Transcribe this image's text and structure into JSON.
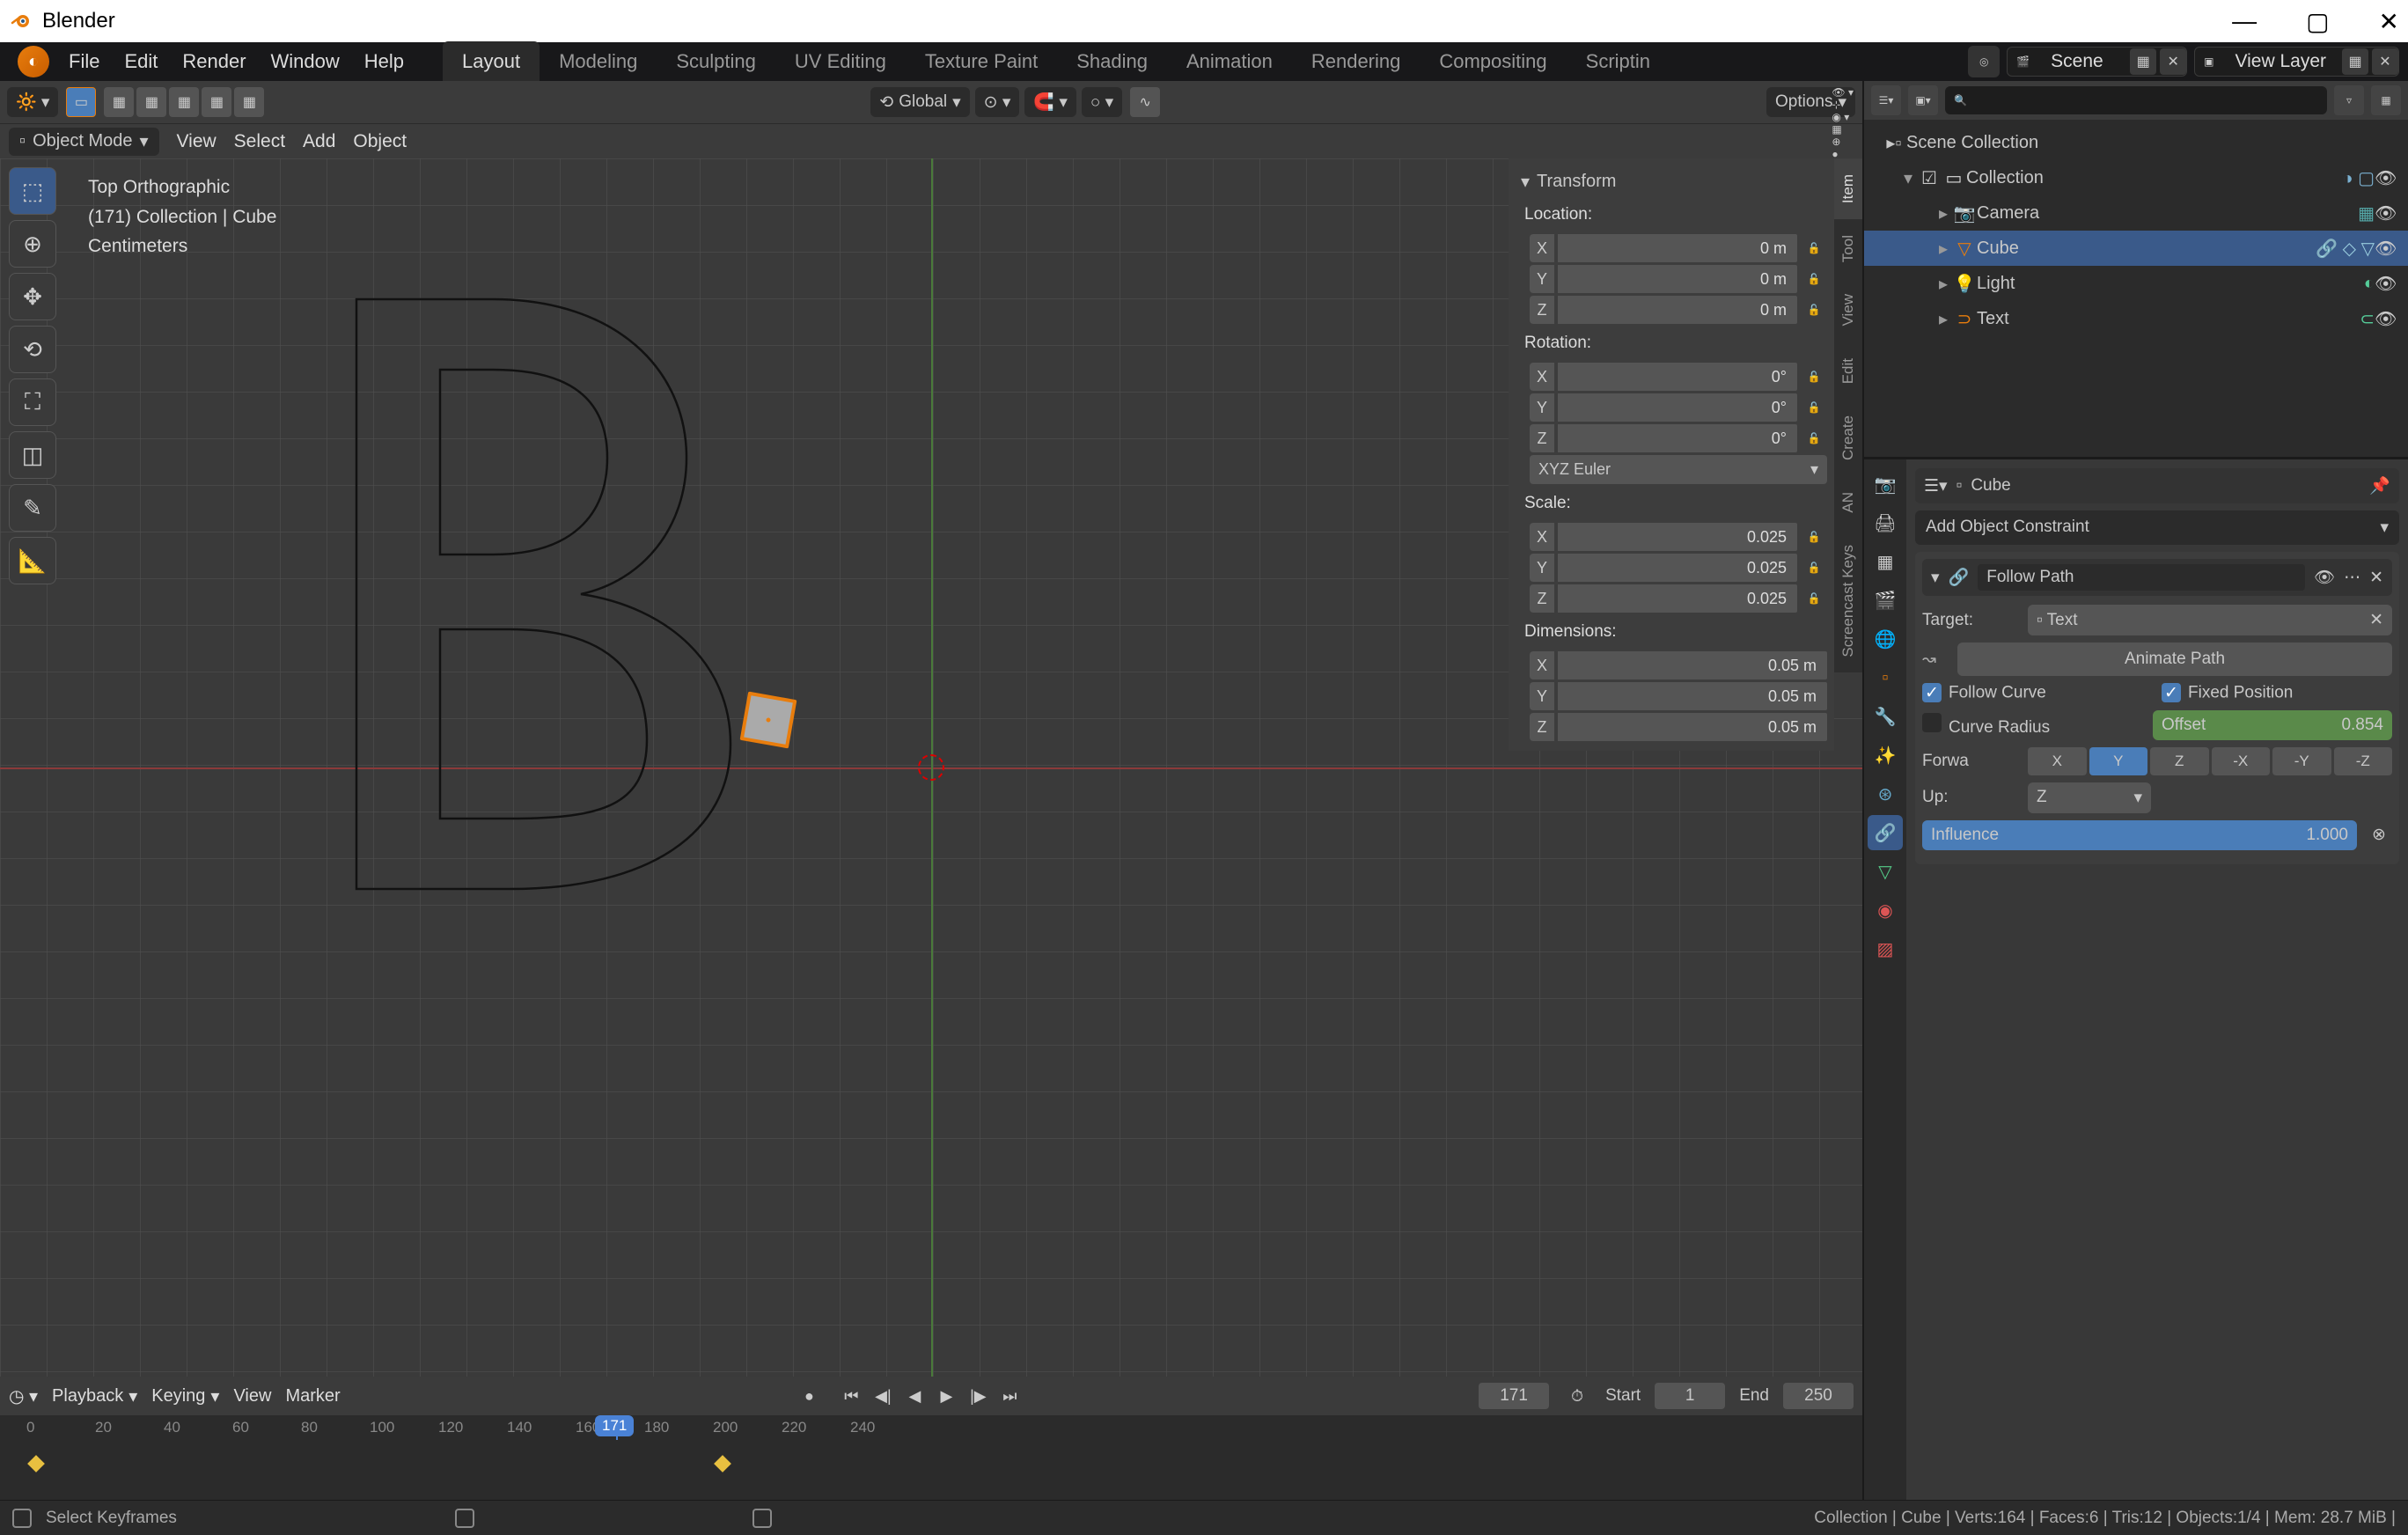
{
  "app": {
    "title": "Blender"
  },
  "menus": [
    "File",
    "Edit",
    "Render",
    "Window",
    "Help"
  ],
  "workspace_tabs": [
    "Layout",
    "Modeling",
    "Sculpting",
    "UV Editing",
    "Texture Paint",
    "Shading",
    "Animation",
    "Rendering",
    "Compositing",
    "Scriptin"
  ],
  "workspace_active": "Layout",
  "scene": {
    "name": "Scene"
  },
  "view_layer": {
    "name": "View Layer"
  },
  "viewport_header": {
    "orientation": "Global",
    "options": "Options"
  },
  "mode": {
    "label": "Object Mode"
  },
  "header_menus": [
    "View",
    "Select",
    "Add",
    "Object"
  ],
  "viewport_info": {
    "view": "Top Orthographic",
    "context": "(171) Collection | Cube",
    "units": "Centimeters"
  },
  "npanel": {
    "title": "Transform",
    "tabs": [
      "Item",
      "Tool",
      "View",
      "Edit",
      "Create",
      "AN",
      "Screencast Keys"
    ],
    "active_tab": "Item",
    "location": {
      "label": "Location:",
      "x": "0 m",
      "y": "0 m",
      "z": "0 m"
    },
    "rotation": {
      "label": "Rotation:",
      "x": "0°",
      "y": "0°",
      "z": "0°",
      "mode": "XYZ Euler"
    },
    "scale": {
      "label": "Scale:",
      "x": "0.025",
      "y": "0.025",
      "z": "0.025"
    },
    "dimensions": {
      "label": "Dimensions:",
      "x": "0.05 m",
      "y": "0.05 m",
      "z": "0.05 m"
    }
  },
  "outliner": {
    "root": "Scene Collection",
    "collection": "Collection",
    "items": [
      {
        "name": "Camera",
        "icon": "camera-icon"
      },
      {
        "name": "Cube",
        "icon": "mesh-icon",
        "active": true
      },
      {
        "name": "Light",
        "icon": "light-icon"
      },
      {
        "name": "Text",
        "icon": "text-icon"
      }
    ]
  },
  "properties": {
    "breadcrumb_object": "Cube",
    "add_constraint": "Add Object Constraint",
    "constraint": {
      "type": "Follow Path",
      "target_label": "Target:",
      "target": "Text",
      "animate_path": "Animate Path",
      "follow_curve": "Follow Curve",
      "fixed_position": "Fixed Position",
      "curve_radius": "Curve Radius",
      "offset_label": "Offset",
      "offset": "0.854",
      "forward_label": "Forwa",
      "axes": [
        "X",
        "Y",
        "Z",
        "-X",
        "-Y",
        "-Z"
      ],
      "forward_active": "Y",
      "up_label": "Up:",
      "up": "Z",
      "influence_label": "Influence",
      "influence": "1.000"
    }
  },
  "timeline": {
    "playback": "Playback",
    "keying": "Keying",
    "view": "View",
    "marker": "Marker",
    "current_frame": "171",
    "start_label": "Start",
    "start": "1",
    "end_label": "End",
    "end": "250",
    "ticks": [
      "0",
      "20",
      "40",
      "60",
      "80",
      "100",
      "120",
      "140",
      "160",
      "171",
      "180",
      "200",
      "220",
      "240"
    ],
    "keyframes": [
      40,
      820
    ]
  },
  "statusbar": {
    "left": "Select Keyframes",
    "right": "Collection | Cube | Verts:164 | Faces:6 | Tris:12 | Objects:1/4 | Mem: 28.7 MiB |"
  }
}
